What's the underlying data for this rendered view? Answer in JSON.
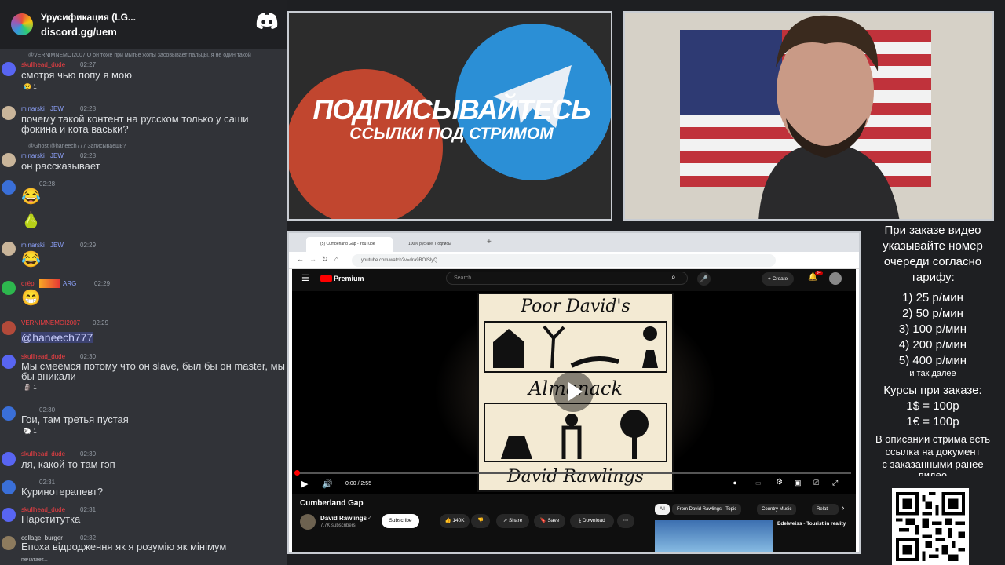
{
  "colors": {
    "accent_red": "#f23f43",
    "discord_blurple": "#5865f2",
    "name_purple": "#8fa4ff",
    "youtube_red": "#ff0000",
    "chat_bg": "#313338"
  },
  "chat": {
    "server_name": "Урусификация (LG...",
    "server_link": "discord.gg/uem",
    "typing": "печатает...",
    "messages": [
      {
        "reply": "@VERNIMNEMOI2007 О он тоже при мытье жопы засовывает пальцы, я не один такой",
        "name": "skullhead_dude",
        "time": "02:27",
        "text": "смотря чью попу я мою",
        "reaction": "1"
      },
      {
        "name": "minarski",
        "badge": "JEW",
        "time": "02:28",
        "text": "почему такой контент на русском только у саши"
      },
      {
        "text": "фокина и кота васьки?"
      },
      {
        "reply": "@Ghost @haneech777 Записываешь?",
        "name": "minarski",
        "badge": "JEW",
        "time": "02:28",
        "text": "он рассказывает"
      },
      {
        "time": "02:28",
        "emoji": "😂"
      },
      {
        "emoji": "🍐"
      },
      {
        "name": "minarski",
        "badge": "JEW",
        "time": "02:29",
        "emoji": "😂"
      },
      {
        "name": "стёр",
        "badge": "ARG",
        "time": "02:29",
        "emoji": "😁"
      },
      {
        "name": "VERNIMNEMOI2007",
        "time": "02:29",
        "text": "@haneech777"
      },
      {
        "name": "skullhead_dude",
        "time": "02:30",
        "text": "Мы смеёмся потому что он slave, был бы он master, мы",
        "reaction": "1"
      },
      {
        "text": "бы вникали"
      },
      {
        "time": "02:30",
        "text": "Гои, там третья пустая",
        "reaction": "1"
      },
      {
        "name": "skullhead_dude",
        "time": "02:30",
        "text": "ля, какой то там гэп"
      },
      {
        "time": "02:31",
        "text": "Куринотерапевт?"
      },
      {
        "name": "skullhead_dude",
        "time": "02:31",
        "text": "Парститутка"
      },
      {
        "name": "collage_burger",
        "time": "02:32",
        "text": "Епоха відродження як я розумію як мінімум"
      }
    ]
  },
  "promo": {
    "title": "ПОДПИСЫВАЙТЕСЬ",
    "subtitle": "ССЫЛКИ ПОД СТРИМОМ"
  },
  "browser": {
    "tab1": "(5) Cumberland Gap - YouTube",
    "tab2": "100% русные. Подписы",
    "url": "youtube.com/watch?v=dra9BOISlyQ",
    "yt_logo": "Premium",
    "search_placeholder": "Search",
    "create_label": "Create",
    "notif_count": "9+",
    "album_title": "Poor David's",
    "album_mid": "Almanack",
    "album_artist": "David Rawlings",
    "time": "0:00 / 2:55",
    "progress": 0,
    "video_title": "Cumberland Gap",
    "channel": "David Rawlings",
    "subscribers": "7.7K subscribers",
    "subscribe": "Subscribe",
    "likes": "140K",
    "share": "Share",
    "save": "Save",
    "download": "Download",
    "chips": [
      "All",
      "From David Rawlings - Topic",
      "Country Music",
      "Relat"
    ],
    "rec_title": "Edelweiss - Tourist in reality"
  },
  "info": {
    "lines": [
      "При заказе видео",
      "указывайте номер",
      "очереди согласно",
      "тарифу:"
    ],
    "tariffs": [
      "1) 25 р/мин",
      "2) 50 р/мин",
      "3) 100 р/мин",
      "4) 200 р/мин",
      "5) 400 р/мин"
    ],
    "etc": "и так далее",
    "rates_title": "Курсы при заказе:",
    "rate1": "1$ = 100р",
    "rate2": "1€ = 100р",
    "desc": [
      "В описании стрима есть",
      "ссылка на документ",
      "с заказанными ранее",
      "видео"
    ]
  }
}
